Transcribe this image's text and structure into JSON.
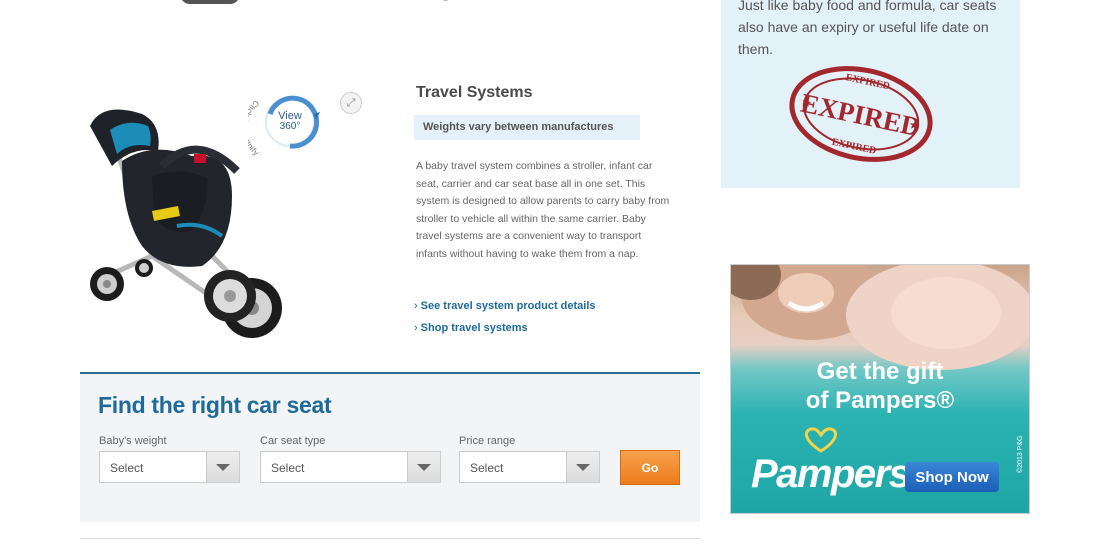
{
  "product": {
    "title": "Travel Systems",
    "weight_tag": "Weights vary between manufactures",
    "description": "A baby travel system combines a stroller, infant car seat, carrier and car seat base all in one set. This system is designed to allow parents to carry baby from stroller to vehicle all within the same carrier. Baby travel systems are a convenient way to transport infants without having to wake them from a nap.",
    "links": [
      "See travel system product details",
      "Shop travel systems"
    ],
    "view360": {
      "line1": "View",
      "line2": "360°",
      "caption": "Click to magnify"
    }
  },
  "finder": {
    "title": "Find the right car seat",
    "fields": [
      {
        "label": "Baby's weight",
        "value": "Select"
      },
      {
        "label": "Car seat type",
        "value": "Select"
      },
      {
        "label": "Price range",
        "value": "Select"
      }
    ],
    "go_label": "Go"
  },
  "expiry": {
    "text": "Just like baby food and formula, car seats also have an expiry or useful life date on them.",
    "stamp": {
      "main": "EXPIRED",
      "ring": "EXPIRED"
    }
  },
  "ad": {
    "headline_line1": "Get the gift",
    "headline_line2": "of Pampers®",
    "logo": "Pampers",
    "cta": "Shop Now",
    "copyright": "©2013 P&G"
  },
  "colors": {
    "link_blue": "#1e6b9a",
    "go_orange": "#ec7c1c",
    "tag_bg": "#e4f1f8",
    "stamp_red": "#a3282d",
    "ad_teal": "#2bb3b2"
  }
}
